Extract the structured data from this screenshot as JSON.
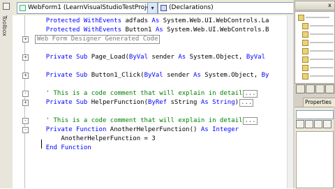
{
  "toolbox": {
    "label": "Toolbox"
  },
  "dropdowns": {
    "class_selector": "WebForm1 (LearnVisualStudioTestProje",
    "member_selector": "(Declarations)"
  },
  "code_lines": [
    {
      "id": "l1",
      "toggle": "",
      "segments": [
        {
          "t": "    ",
          "c": "tx"
        },
        {
          "t": "Protected WithEvents",
          "c": "kw"
        },
        {
          "t": " adfads ",
          "c": "tx"
        },
        {
          "t": "As",
          "c": "kw"
        },
        {
          "t": " System.Web.UI.WebControls.La",
          "c": "tx"
        }
      ]
    },
    {
      "id": "l2",
      "toggle": "",
      "segments": [
        {
          "t": "    ",
          "c": "tx"
        },
        {
          "t": "Protected WithEvents",
          "c": "kw"
        },
        {
          "t": " Button1 ",
          "c": "tx"
        },
        {
          "t": "As",
          "c": "kw"
        },
        {
          "t": " System.Web.UI.WebControls.B",
          "c": "tx"
        }
      ]
    },
    {
      "id": "l3",
      "toggle": "+",
      "region": "Web Form Designer Generated Code",
      "segments": []
    },
    {
      "id": "l4",
      "toggle": "",
      "segments": []
    },
    {
      "id": "l5",
      "toggle": "+",
      "segments": [
        {
          "t": "    ",
          "c": "tx"
        },
        {
          "t": "Private Sub",
          "c": "kw"
        },
        {
          "t": " Page_Load(",
          "c": "tx"
        },
        {
          "t": "ByVal",
          "c": "kw"
        },
        {
          "t": " sender ",
          "c": "tx"
        },
        {
          "t": "As",
          "c": "kw"
        },
        {
          "t": " System.Object, ",
          "c": "tx"
        },
        {
          "t": "ByVal",
          "c": "kw"
        }
      ]
    },
    {
      "id": "l6",
      "toggle": "",
      "segments": []
    },
    {
      "id": "l7",
      "toggle": "+",
      "segments": [
        {
          "t": "    ",
          "c": "tx"
        },
        {
          "t": "Private Sub",
          "c": "kw"
        },
        {
          "t": " Button1_Click(",
          "c": "tx"
        },
        {
          "t": "ByVal",
          "c": "kw"
        },
        {
          "t": " sender ",
          "c": "tx"
        },
        {
          "t": "As",
          "c": "kw"
        },
        {
          "t": " System.Object, ",
          "c": "tx"
        },
        {
          "t": "By",
          "c": "kw"
        }
      ]
    },
    {
      "id": "l8",
      "toggle": "",
      "segments": []
    },
    {
      "id": "l9",
      "toggle": "-",
      "ellipsis": "...",
      "segments": [
        {
          "t": "    ' This is a code comment that will explain in detail",
          "c": "cm"
        }
      ]
    },
    {
      "id": "l10",
      "toggle": "+",
      "ellipsis": "...",
      "segments": [
        {
          "t": "    ",
          "c": "tx"
        },
        {
          "t": "Private Sub",
          "c": "kw"
        },
        {
          "t": " HelperFunction(",
          "c": "tx"
        },
        {
          "t": "ByRef",
          "c": "kw"
        },
        {
          "t": " sString ",
          "c": "tx"
        },
        {
          "t": "As String",
          "c": "kw"
        },
        {
          "t": ")",
          "c": "tx"
        }
      ]
    },
    {
      "id": "l11",
      "toggle": "",
      "segments": []
    },
    {
      "id": "l12",
      "toggle": "-",
      "ellipsis": "...",
      "segments": [
        {
          "t": "    ' This is a code comment that will explain in detail",
          "c": "cm"
        }
      ]
    },
    {
      "id": "l13",
      "toggle": "-",
      "segments": [
        {
          "t": "    ",
          "c": "tx"
        },
        {
          "t": "Private Function",
          "c": "kw"
        },
        {
          "t": " AnotherHelperFunction() ",
          "c": "tx"
        },
        {
          "t": "As Integer",
          "c": "kw"
        }
      ]
    },
    {
      "id": "l14",
      "toggle": "",
      "segments": [
        {
          "t": "        AnotherHelperFunction = 3",
          "c": "tx"
        }
      ]
    },
    {
      "id": "l15",
      "toggle": "",
      "segments": [
        {
          "t": "    ",
          "c": "tx"
        },
        {
          "t": "End Function",
          "c": "kw"
        }
      ]
    }
  ],
  "side_panels": {
    "properties_tab": "Properties",
    "close_glyph": "x",
    "dropdown_arrow": "▾"
  },
  "colors": {
    "keyword": "#0000ff",
    "comment": "#008000",
    "text": "#000000"
  }
}
